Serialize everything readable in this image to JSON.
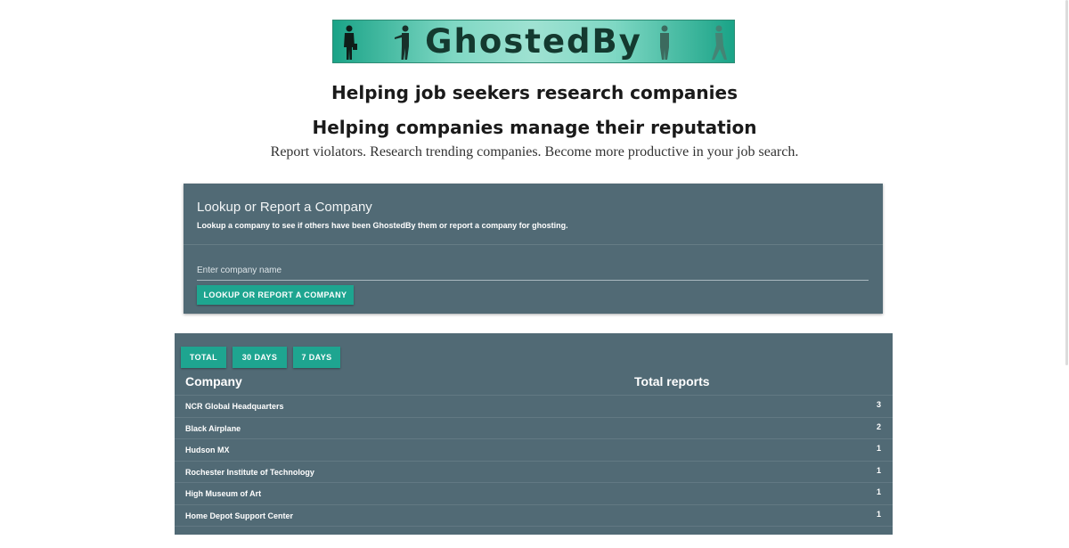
{
  "logo": {
    "text": "GhostedBy"
  },
  "hero": {
    "line1": "Helping job seekers research companies",
    "line2": "Helping companies manage their reputation",
    "tagline": "Report violators. Research trending companies. Become more productive in your job search."
  },
  "lookup": {
    "title": "Lookup or Report a Company",
    "subtitle": "Lookup a company to see if others have been GhostedBy them or report a company for ghosting.",
    "input_placeholder": "Enter company name",
    "input_value": "",
    "button_label": "LOOKUP OR REPORT A COMPANY"
  },
  "stats": {
    "tabs": [
      "TOTAL",
      "30 DAYS",
      "7 DAYS"
    ],
    "columns": {
      "company": "Company",
      "total": "Total reports"
    },
    "rows": [
      {
        "name": "NCR Global Headquarters",
        "count": "3"
      },
      {
        "name": "Black Airplane",
        "count": "2"
      },
      {
        "name": "Hudson MX",
        "count": "1"
      },
      {
        "name": "Rochester Institute of Technology",
        "count": "1"
      },
      {
        "name": "High Museum of Art",
        "count": "1"
      },
      {
        "name": "Home Depot Support Center",
        "count": "1"
      }
    ]
  },
  "colors": {
    "panel": "#516a75",
    "accent_button": "#1ea590",
    "logo_gradient_edge": "#1aa387",
    "logo_gradient_mid": "#9fe2d2"
  },
  "icons": [
    "businessman-silhouette-icon",
    "walking-man-silhouette-icon"
  ]
}
